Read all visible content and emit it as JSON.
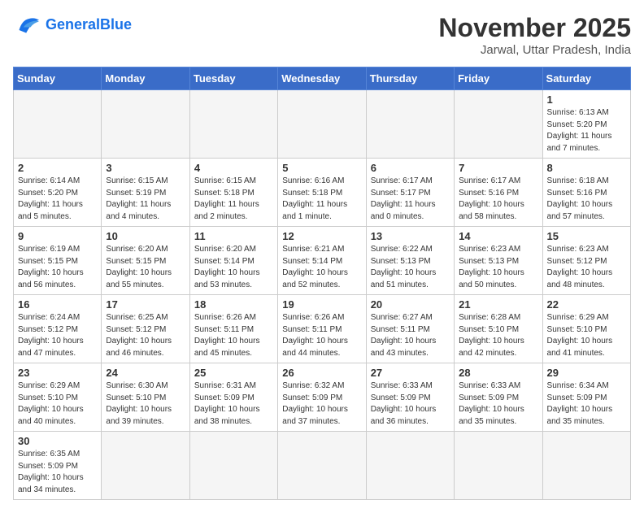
{
  "header": {
    "logo_general": "General",
    "logo_blue": "Blue",
    "month_title": "November 2025",
    "subtitle": "Jarwal, Uttar Pradesh, India"
  },
  "weekdays": [
    "Sunday",
    "Monday",
    "Tuesday",
    "Wednesday",
    "Thursday",
    "Friday",
    "Saturday"
  ],
  "days": [
    {
      "date": "",
      "info": ""
    },
    {
      "date": "",
      "info": ""
    },
    {
      "date": "",
      "info": ""
    },
    {
      "date": "",
      "info": ""
    },
    {
      "date": "",
      "info": ""
    },
    {
      "date": "",
      "info": ""
    },
    {
      "date": "1",
      "sunrise": "6:13 AM",
      "sunset": "5:20 PM",
      "daylight": "11 hours and 7 minutes."
    },
    {
      "date": "2",
      "sunrise": "6:14 AM",
      "sunset": "5:20 PM",
      "daylight": "11 hours and 5 minutes."
    },
    {
      "date": "3",
      "sunrise": "6:15 AM",
      "sunset": "5:19 PM",
      "daylight": "11 hours and 4 minutes."
    },
    {
      "date": "4",
      "sunrise": "6:15 AM",
      "sunset": "5:18 PM",
      "daylight": "11 hours and 2 minutes."
    },
    {
      "date": "5",
      "sunrise": "6:16 AM",
      "sunset": "5:18 PM",
      "daylight": "11 hours and 1 minute."
    },
    {
      "date": "6",
      "sunrise": "6:17 AM",
      "sunset": "5:17 PM",
      "daylight": "11 hours and 0 minutes."
    },
    {
      "date": "7",
      "sunrise": "6:17 AM",
      "sunset": "5:16 PM",
      "daylight": "10 hours and 58 minutes."
    },
    {
      "date": "8",
      "sunrise": "6:18 AM",
      "sunset": "5:16 PM",
      "daylight": "10 hours and 57 minutes."
    },
    {
      "date": "9",
      "sunrise": "6:19 AM",
      "sunset": "5:15 PM",
      "daylight": "10 hours and 56 minutes."
    },
    {
      "date": "10",
      "sunrise": "6:20 AM",
      "sunset": "5:15 PM",
      "daylight": "10 hours and 55 minutes."
    },
    {
      "date": "11",
      "sunrise": "6:20 AM",
      "sunset": "5:14 PM",
      "daylight": "10 hours and 53 minutes."
    },
    {
      "date": "12",
      "sunrise": "6:21 AM",
      "sunset": "5:14 PM",
      "daylight": "10 hours and 52 minutes."
    },
    {
      "date": "13",
      "sunrise": "6:22 AM",
      "sunset": "5:13 PM",
      "daylight": "10 hours and 51 minutes."
    },
    {
      "date": "14",
      "sunrise": "6:23 AM",
      "sunset": "5:13 PM",
      "daylight": "10 hours and 50 minutes."
    },
    {
      "date": "15",
      "sunrise": "6:23 AM",
      "sunset": "5:12 PM",
      "daylight": "10 hours and 48 minutes."
    },
    {
      "date": "16",
      "sunrise": "6:24 AM",
      "sunset": "5:12 PM",
      "daylight": "10 hours and 47 minutes."
    },
    {
      "date": "17",
      "sunrise": "6:25 AM",
      "sunset": "5:12 PM",
      "daylight": "10 hours and 46 minutes."
    },
    {
      "date": "18",
      "sunrise": "6:26 AM",
      "sunset": "5:11 PM",
      "daylight": "10 hours and 45 minutes."
    },
    {
      "date": "19",
      "sunrise": "6:26 AM",
      "sunset": "5:11 PM",
      "daylight": "10 hours and 44 minutes."
    },
    {
      "date": "20",
      "sunrise": "6:27 AM",
      "sunset": "5:11 PM",
      "daylight": "10 hours and 43 minutes."
    },
    {
      "date": "21",
      "sunrise": "6:28 AM",
      "sunset": "5:10 PM",
      "daylight": "10 hours and 42 minutes."
    },
    {
      "date": "22",
      "sunrise": "6:29 AM",
      "sunset": "5:10 PM",
      "daylight": "10 hours and 41 minutes."
    },
    {
      "date": "23",
      "sunrise": "6:29 AM",
      "sunset": "5:10 PM",
      "daylight": "10 hours and 40 minutes."
    },
    {
      "date": "24",
      "sunrise": "6:30 AM",
      "sunset": "5:10 PM",
      "daylight": "10 hours and 39 minutes."
    },
    {
      "date": "25",
      "sunrise": "6:31 AM",
      "sunset": "5:09 PM",
      "daylight": "10 hours and 38 minutes."
    },
    {
      "date": "26",
      "sunrise": "6:32 AM",
      "sunset": "5:09 PM",
      "daylight": "10 hours and 37 minutes."
    },
    {
      "date": "27",
      "sunrise": "6:33 AM",
      "sunset": "5:09 PM",
      "daylight": "10 hours and 36 minutes."
    },
    {
      "date": "28",
      "sunrise": "6:33 AM",
      "sunset": "5:09 PM",
      "daylight": "10 hours and 35 minutes."
    },
    {
      "date": "29",
      "sunrise": "6:34 AM",
      "sunset": "5:09 PM",
      "daylight": "10 hours and 35 minutes."
    },
    {
      "date": "30",
      "sunrise": "6:35 AM",
      "sunset": "5:09 PM",
      "daylight": "10 hours and 34 minutes."
    },
    {
      "date": "",
      "info": ""
    },
    {
      "date": "",
      "info": ""
    },
    {
      "date": "",
      "info": ""
    },
    {
      "date": "",
      "info": ""
    },
    {
      "date": "",
      "info": ""
    }
  ]
}
